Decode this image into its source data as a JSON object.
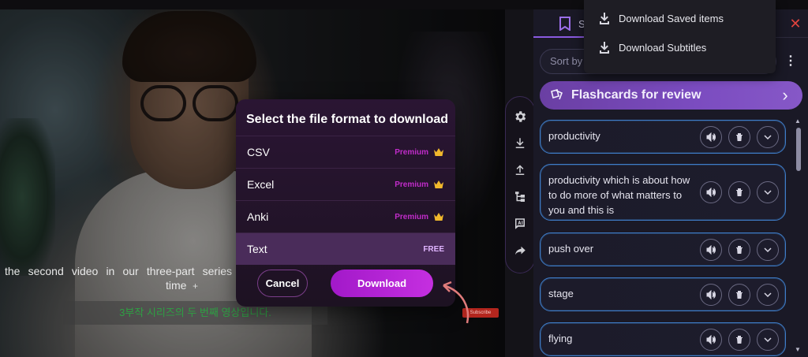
{
  "video": {
    "caption_en_line1": "the second video in our three-part series",
    "caption_en_line2": "time",
    "caption_en_plus": "+",
    "caption_ko": "3부작 시리즈의 두 번째 영상입니다.",
    "subscribe_label": "Subscribe"
  },
  "toolbar": {
    "icons": [
      "gear-icon",
      "download-icon",
      "upload-icon",
      "tree-icon",
      "ai-icon",
      "share-icon"
    ]
  },
  "modal": {
    "title": "Select the file format to download",
    "formats": [
      {
        "name": "CSV",
        "tag": "Premium"
      },
      {
        "name": "Excel",
        "tag": "Premium"
      },
      {
        "name": "Anki",
        "tag": "Premium"
      },
      {
        "name": "Text",
        "tag": "FREE"
      }
    ],
    "selected_index": 3,
    "cancel_label": "Cancel",
    "download_label": "Download"
  },
  "panel": {
    "tab_label": "S",
    "close_label": "✕",
    "sort_placeholder": "Sort by n",
    "more_label": "⋮",
    "review_label": "Flashcards for review",
    "review_chevron": "›",
    "cards": [
      {
        "text": "productivity"
      },
      {
        "text": "productivity which is about how to do more of what matters to you and this is"
      },
      {
        "text": "push over"
      },
      {
        "text": "stage"
      },
      {
        "text": "flying"
      }
    ]
  },
  "dropdown": {
    "items": [
      {
        "label": "Download Saved items"
      },
      {
        "label": "Download Subtitles"
      }
    ]
  },
  "colors": {
    "accent": "#c52fe0",
    "premium": "#c02cc9",
    "card_border": "#3f7cc8",
    "review_bg": "#7b4cc0",
    "close": "#e0433e"
  }
}
